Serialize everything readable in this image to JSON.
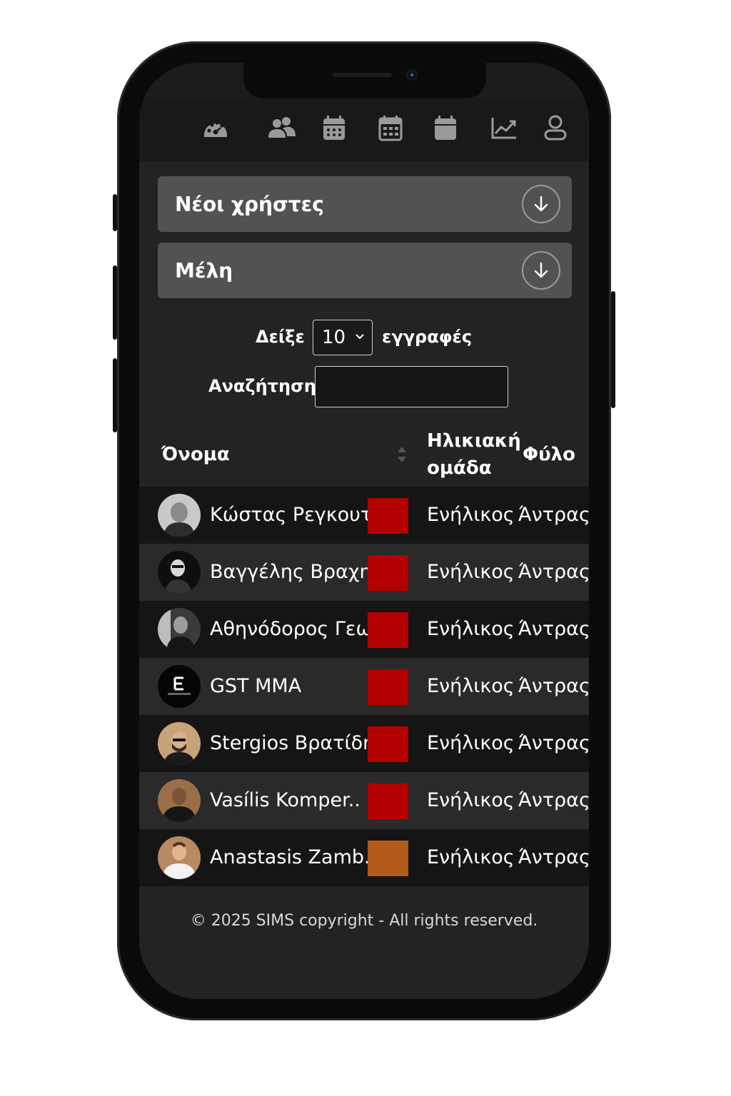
{
  "nav": {
    "icons": [
      "dashboard-gauge-icon",
      "users-icon",
      "calendar-grid-icon",
      "calendar-month-icon",
      "calendar-icon",
      "chart-line-icon",
      "user-profile-icon"
    ]
  },
  "accordions": [
    {
      "title": "Νέοι χρήστες"
    },
    {
      "title": "Μέλη"
    }
  ],
  "table_controls": {
    "show_label": "Δείξε",
    "page_size": "10",
    "entries_label": "εγγραφές",
    "search_label": "Αναζήτηση:",
    "search_value": ""
  },
  "table": {
    "headers": {
      "name": "Όνομα",
      "age_group_line1": "Ηλικιακή",
      "age_group_line2": "ομάδα",
      "gender": "Φύλο"
    },
    "rows": [
      {
        "name": "Κώστας Ρεγκουτ..",
        "color": "#b30000",
        "age_group": "Ενήλικος",
        "gender": "Άντρας"
      },
      {
        "name": "Βαγγέλης Βραχηνίς",
        "color": "#b30000",
        "age_group": "Ενήλικος",
        "gender": "Άντρας"
      },
      {
        "name": "Αθηνόδορος Γεω..",
        "color": "#b30000",
        "age_group": "Ενήλικος",
        "gender": "Άντρας"
      },
      {
        "name": "GST MMA",
        "color": "#b30000",
        "age_group": "Ενήλικος",
        "gender": "Άντρας"
      },
      {
        "name": "Stergios Βρατίδης",
        "color": "#b30000",
        "age_group": "Ενήλικος",
        "gender": "Άντρας"
      },
      {
        "name": "Vasílis Komper..",
        "color": "#b30000",
        "age_group": "Ενήλικος",
        "gender": "Άντρας"
      },
      {
        "name": "Anastasis Zamb..",
        "color": "#b35a1a",
        "age_group": "Ενήλικος",
        "gender": "Άντρας"
      }
    ]
  },
  "footer": {
    "text": "© 2025 SIMS copyright - All rights reserved."
  }
}
